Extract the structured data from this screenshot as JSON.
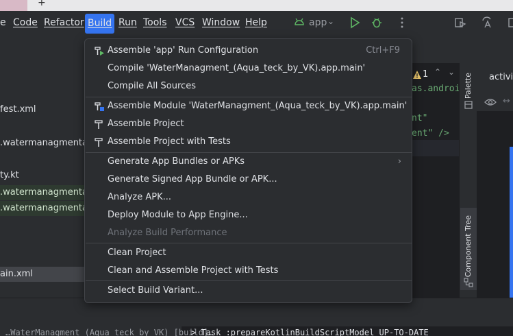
{
  "menubar": {
    "items": [
      {
        "label": "e"
      },
      {
        "label": "Code"
      },
      {
        "label": "Refactor"
      },
      {
        "label": "Build"
      },
      {
        "label": "Run"
      },
      {
        "label": "Tools"
      },
      {
        "label": "VCS"
      },
      {
        "label": "Window"
      },
      {
        "label": "Help"
      }
    ],
    "run_config": "app"
  },
  "project_panel": {
    "lines": [
      "fest.xml",
      ".watermanagmentac",
      "ty.kt",
      ".watermanagmentac",
      ".watermanagmentac",
      "ain.xml"
    ]
  },
  "editor": {
    "warning_count": "1",
    "code_lines": [
      "as.androi",
      "nt\"",
      "ent\" />"
    ]
  },
  "design": {
    "activity_tab": "activit",
    "palette_label": "Palette",
    "component_tree_label": "Component Tree"
  },
  "bottom": {
    "left_text": "…WaterManagment_(Aqua_teck_by_VK) [build]…",
    "right_text": "> Task :prepareKotlinBuildScriptModel UP-TO-DATE"
  },
  "build_menu": {
    "items": [
      {
        "label": "Assemble 'app' Run Configuration",
        "shortcut": "Ctrl+F9",
        "icon": "hammer-run-icon"
      },
      {
        "label": "Compile 'WaterManagment_(Aqua_teck_by_VK).app.main'"
      },
      {
        "label": "Compile All Sources"
      },
      {
        "label": "Assemble Module 'WaterManagment_(Aqua_teck_by_VK).app.main'",
        "icon": "hammer-module-icon"
      },
      {
        "label": "Assemble Project",
        "icon": "hammer-icon"
      },
      {
        "label": "Assemble Project with Tests",
        "icon": "hammer-icon"
      },
      {
        "label": "Generate App Bundles or APKs",
        "submenu": true
      },
      {
        "label": "Generate Signed App Bundle or APK..."
      },
      {
        "label": "Analyze APK..."
      },
      {
        "label": "Deploy Module to App Engine..."
      },
      {
        "label": "Analyze Build Performance",
        "disabled": true
      },
      {
        "label": "Clean Project"
      },
      {
        "label": "Clean and Assemble Project with Tests"
      },
      {
        "label": "Select Build Variant..."
      }
    ]
  },
  "colors": {
    "accent": "#3574f0",
    "background": "#2b2d30",
    "editor_bg": "#1e1f22",
    "run_green": "#5fb865"
  }
}
